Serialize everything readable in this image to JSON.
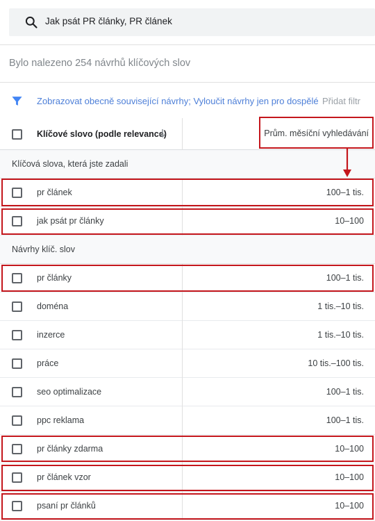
{
  "search": {
    "query": "Jak psát PR články, PR článek",
    "icon": "search-icon"
  },
  "summary": {
    "text": "Bylo nalezeno 254 návrhů klíčových slov"
  },
  "filter": {
    "icon": "filter-icon",
    "link": "Zobrazovat obecně související návrhy; Vyloučit návrhy jen pro dospělé",
    "add": "Přidat filtr"
  },
  "table": {
    "col_keyword": "Klíčové slovo (podle relevance)",
    "col_volume": "Prům. měsíční vyhledávání",
    "group_entered": "Klíčová slova, která jste zadali",
    "group_suggested": "Návrhy klíč. slov",
    "entered": [
      {
        "keyword": "pr článek",
        "volume": "100–1 tis."
      },
      {
        "keyword": "jak psát pr články",
        "volume": "10–100"
      }
    ],
    "suggested": [
      {
        "keyword": "pr články",
        "volume": "100–1 tis."
      },
      {
        "keyword": "doména",
        "volume": "1 tis.–10 tis."
      },
      {
        "keyword": "inzerce",
        "volume": "1 tis.–10 tis."
      },
      {
        "keyword": "práce",
        "volume": "10 tis.–100 tis."
      },
      {
        "keyword": "seo optimalizace",
        "volume": "100–1 tis."
      },
      {
        "keyword": "ppc reklama",
        "volume": "100–1 tis."
      },
      {
        "keyword": "pr články zdarma",
        "volume": "10–100"
      },
      {
        "keyword": "pr článek vzor",
        "volume": "10–100"
      },
      {
        "keyword": "psaní pr článků",
        "volume": "10–100"
      }
    ]
  },
  "colors": {
    "link": "#4d7fd8",
    "highlight": "#c4161c",
    "filter_icon": "#4285f4"
  }
}
